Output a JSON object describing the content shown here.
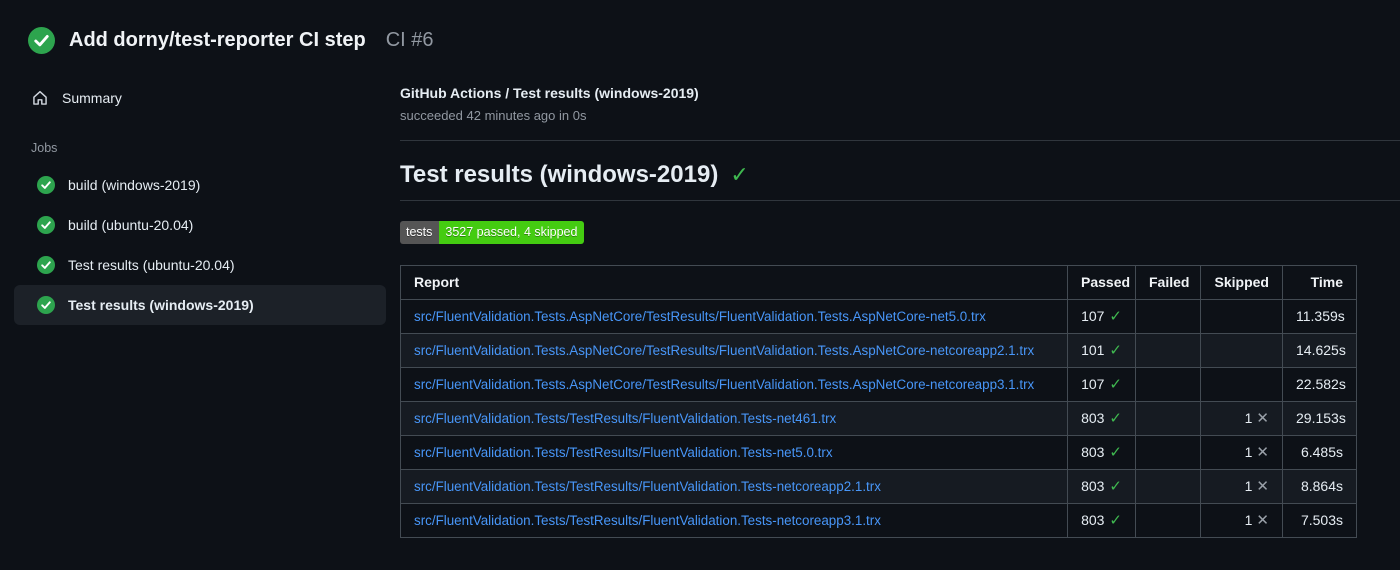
{
  "colors": {
    "success_green": "#2da44e",
    "check_green": "#3fb950",
    "badge_label_bg": "#555555",
    "badge_value_bg": "#44cc11",
    "link_blue": "#4896f8"
  },
  "header": {
    "title": "Add dorny/test-reporter CI step",
    "run_number": "CI #6"
  },
  "sidebar": {
    "summary_label": "Summary",
    "jobs_section_label": "Jobs",
    "jobs": [
      {
        "label": "build (windows-2019)",
        "selected": false
      },
      {
        "label": "build (ubuntu-20.04)",
        "selected": false
      },
      {
        "label": "Test results (ubuntu-20.04)",
        "selected": false
      },
      {
        "label": "Test results (windows-2019)",
        "selected": true
      }
    ]
  },
  "main": {
    "breadcrumb": "GitHub Actions / Test results (windows-2019)",
    "status_line": "succeeded 42 minutes ago in 0s",
    "heading": "Test results (windows-2019)",
    "heading_check": "✓",
    "badge": {
      "label": "tests",
      "value": "3527 passed, 4 skipped"
    },
    "table": {
      "columns": [
        "Report",
        "Passed",
        "Failed",
        "Skipped",
        "Time"
      ],
      "pass_icon": "✓",
      "skip_icon": "✕",
      "rows": [
        {
          "report": "src/FluentValidation.Tests.AspNetCore/TestResults/FluentValidation.Tests.AspNetCore-net5.0.trx",
          "passed": "107",
          "failed": "",
          "skipped": "",
          "time": "11.359s"
        },
        {
          "report": "src/FluentValidation.Tests.AspNetCore/TestResults/FluentValidation.Tests.AspNetCore-netcoreapp2.1.trx",
          "passed": "101",
          "failed": "",
          "skipped": "",
          "time": "14.625s"
        },
        {
          "report": "src/FluentValidation.Tests.AspNetCore/TestResults/FluentValidation.Tests.AspNetCore-netcoreapp3.1.trx",
          "passed": "107",
          "failed": "",
          "skipped": "",
          "time": "22.582s"
        },
        {
          "report": "src/FluentValidation.Tests/TestResults/FluentValidation.Tests-net461.trx",
          "passed": "803",
          "failed": "",
          "skipped": "1",
          "time": "29.153s"
        },
        {
          "report": "src/FluentValidation.Tests/TestResults/FluentValidation.Tests-net5.0.trx",
          "passed": "803",
          "failed": "",
          "skipped": "1",
          "time": "6.485s"
        },
        {
          "report": "src/FluentValidation.Tests/TestResults/FluentValidation.Tests-netcoreapp2.1.trx",
          "passed": "803",
          "failed": "",
          "skipped": "1",
          "time": "8.864s"
        },
        {
          "report": "src/FluentValidation.Tests/TestResults/FluentValidation.Tests-netcoreapp3.1.trx",
          "passed": "803",
          "failed": "",
          "skipped": "1",
          "time": "7.503s"
        }
      ]
    }
  }
}
